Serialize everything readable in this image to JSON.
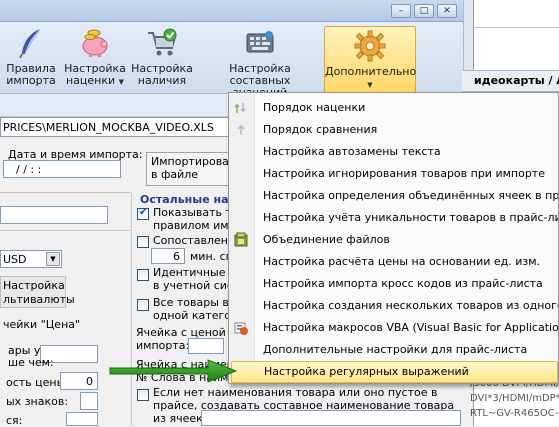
{
  "ribbon": {
    "buttons": [
      {
        "label1": "Правила",
        "label2": "импорта",
        "has_arrow": false
      },
      {
        "label1": "Настройка",
        "label2": "наценки",
        "has_arrow": true
      },
      {
        "label1": "Настройка",
        "label2": "наличия",
        "has_arrow": false
      },
      {
        "label1": "Настройка составных",
        "label2": "значений",
        "has_arrow": false
      },
      {
        "label1": "Дополнительно",
        "label2": "",
        "has_arrow": true
      }
    ]
  },
  "right_window": {
    "header": "идеокарты / АТ",
    "lines": [
      "/5000 DVI-I/HDMI/",
      "DVI*3/HDMI/mDP*",
      "RTL~GV-R465OC-1"
    ]
  },
  "form": {
    "path": "PRICES\\MERLION_MOCKBA_VIDEO.XLS",
    "import_date_label": "Дата и время импорта:",
    "import_date_value": "/ /   : :",
    "imported_file_label1": "Импортироват",
    "imported_file_label2": "в файле",
    "other_settings_title": "Остальные нас",
    "currency_value": "USD",
    "currency_btn1": "Настройка",
    "currency_btn2": "льтивалюты",
    "price_cell_label": "чейки \"Цена\"",
    "left_rows": [
      "ары у",
      "ше чем:",
      "ость цены:",
      "ых знаков:",
      "ся:"
    ],
    "price_precision_value": "0",
    "checks": [
      {
        "line1": "Показывать то",
        "line2": "правилом импор",
        "checked": true
      },
      {
        "line1": "Сопоставлени",
        "line2": "",
        "checked": false
      },
      {
        "line1": "Идентичные к",
        "line2": "в учетной сист",
        "checked": false
      },
      {
        "line1": "Все товары в п",
        "line2": "одной категор",
        "checked": false
      }
    ],
    "min_label": "мин. сп",
    "min_value": "6",
    "price_name_cell": "Ячейка с ценой со",
    "import_label": "импорта:",
    "name_cell_label": "Ячейка с наимено",
    "words_label": "№ Слова в наимен",
    "bottom_check_line1": "Если нет наименования товара или оно пустое в",
    "bottom_check_line2": "прайсе, создавать составное наименование товара",
    "bottom_check_line3": "из ячеек:"
  },
  "menu": {
    "items": [
      {
        "label": "Порядок наценки",
        "icon": "arrows-icon"
      },
      {
        "label": "Порядок сравнения",
        "icon": "arrows-icon"
      },
      {
        "label": "Настройка автозамены текста",
        "icon": ""
      },
      {
        "label": "Настройка игнорирования товаров при импорте",
        "icon": ""
      },
      {
        "label": "Настройка определения объединённых ячеек в прайс-л",
        "icon": ""
      },
      {
        "label": "Настройка учёта уникальности товаров в прайс-листе",
        "icon": ""
      },
      {
        "label": "Объединение файлов",
        "icon": "merge-files-icon"
      },
      {
        "label": "Настройка расчёта цены на основании ед. изм.",
        "icon": ""
      },
      {
        "label": "Настройка импорта кросс кодов из прайс-листа",
        "icon": ""
      },
      {
        "label": "Настройка создания нескольких товаров из одного тов",
        "icon": ""
      },
      {
        "label": "Настройка макросов VBA (Visual Basic for Applications)",
        "icon": "vba-icon"
      },
      {
        "label": "Дополнительные настройки для прайс-листа",
        "icon": ""
      },
      {
        "label": "Настройка регулярных выражений",
        "icon": "",
        "highlighted": true
      }
    ]
  }
}
